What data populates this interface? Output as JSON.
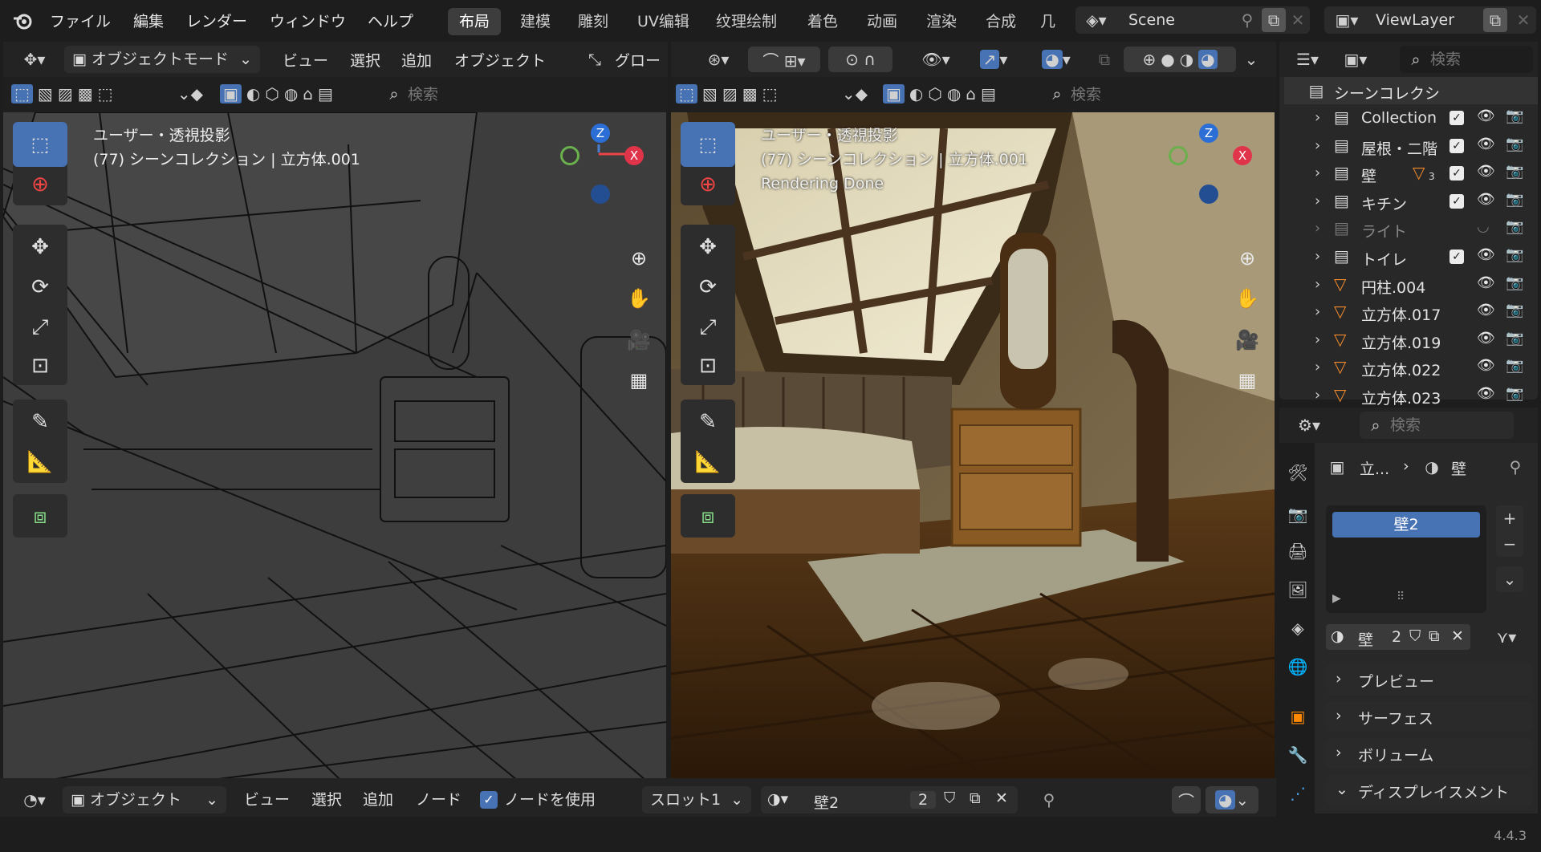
{
  "menu": {
    "file": "ファイル",
    "edit": "編集",
    "render": "レンダー",
    "window": "ウィンドウ",
    "help": "ヘルプ"
  },
  "workspaces": [
    "布局",
    "建模",
    "雕刻",
    "UV编辑",
    "纹理绘制",
    "着色",
    "动画",
    "渲染",
    "合成",
    "几何"
  ],
  "scene": "Scene",
  "view_layer": "ViewLayer",
  "left_viewport": {
    "mode": "オブジェクトモード",
    "menus": [
      "ビュー",
      "選択",
      "追加",
      "オブジェクト"
    ],
    "transform": "グロー",
    "search_placeholder": "検索",
    "overlay_line1": "ユーザー・透視投影",
    "overlay_line2": "(77) シーンコレクション | 立方体.001"
  },
  "right_viewport": {
    "search_placeholder": "検索",
    "overlay_line1": "ユーザー・透視投影",
    "overlay_line2": "(77) シーンコレクション | 立方体.001",
    "overlay_line3": "Rendering Done"
  },
  "gizmo": {
    "z": "Z",
    "x": "X"
  },
  "outliner": {
    "search_placeholder": "検索",
    "root": "シーンコレクシ",
    "items": [
      {
        "label": "Collection",
        "type": "collection"
      },
      {
        "label": "屋根・二階",
        "type": "collection"
      },
      {
        "label": "壁",
        "type": "collection",
        "badge": "3"
      },
      {
        "label": "キチン",
        "type": "collection"
      },
      {
        "label": "ライト",
        "type": "collection-disabled"
      },
      {
        "label": "トイレ",
        "type": "collection"
      },
      {
        "label": "円柱.004",
        "type": "mesh"
      },
      {
        "label": "立方体.017",
        "type": "mesh"
      },
      {
        "label": "立方体.019",
        "type": "mesh"
      },
      {
        "label": "立方体.022",
        "type": "mesh"
      },
      {
        "label": "立方体.023",
        "type": "mesh"
      }
    ]
  },
  "properties": {
    "search_placeholder": "検索",
    "breadcrumb_object": "立...",
    "breadcrumb_material": "壁",
    "slot": "壁2",
    "material_name": "壁",
    "users": "2",
    "panels": [
      "プレビュー",
      "サーフェス",
      "ボリューム",
      "ディスプレイスメント"
    ]
  },
  "bottom_bar": {
    "mode": "オブジェクト",
    "menus": [
      "ビュー",
      "選択",
      "追加",
      "ノード"
    ],
    "use_nodes": "ノードを使用",
    "slot": "スロット1",
    "material": "壁2",
    "users": "2"
  },
  "version": "4.4.3"
}
